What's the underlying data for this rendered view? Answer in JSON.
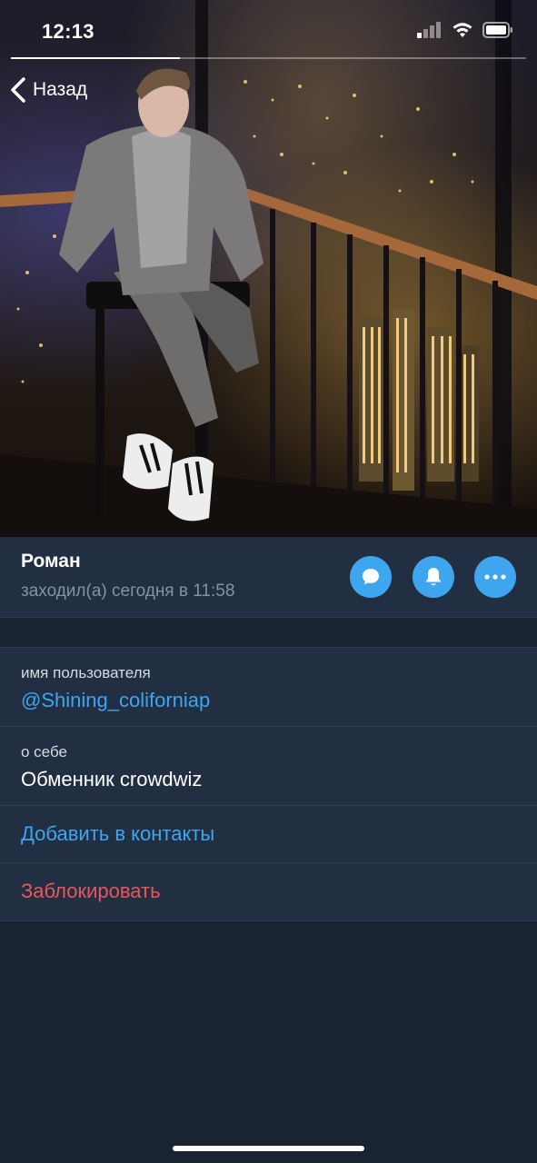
{
  "status_bar": {
    "time": "12:13"
  },
  "navigation": {
    "back_label": "Назад"
  },
  "profile": {
    "name": "Роман",
    "last_seen": "заходил(а) сегодня в 11:58",
    "actions": [
      {
        "name": "message",
        "icon": "chat-bubble-icon"
      },
      {
        "name": "mute",
        "icon": "bell-icon"
      },
      {
        "name": "more",
        "icon": "more-dots-icon"
      }
    ]
  },
  "info": {
    "username_label": "имя пользователя",
    "username_value": "@Shining_coliforniap",
    "bio_label": "о себе",
    "bio_value": "Обменник crowdwiz",
    "add_contact": "Добавить в контакты",
    "block": "Заблокировать"
  },
  "colors": {
    "background": "#1a2331",
    "cell_background": "#222f42",
    "accent_blue": "#3ea6ef",
    "destructive_red": "#e9565c",
    "secondary_text": "#8393a6"
  }
}
